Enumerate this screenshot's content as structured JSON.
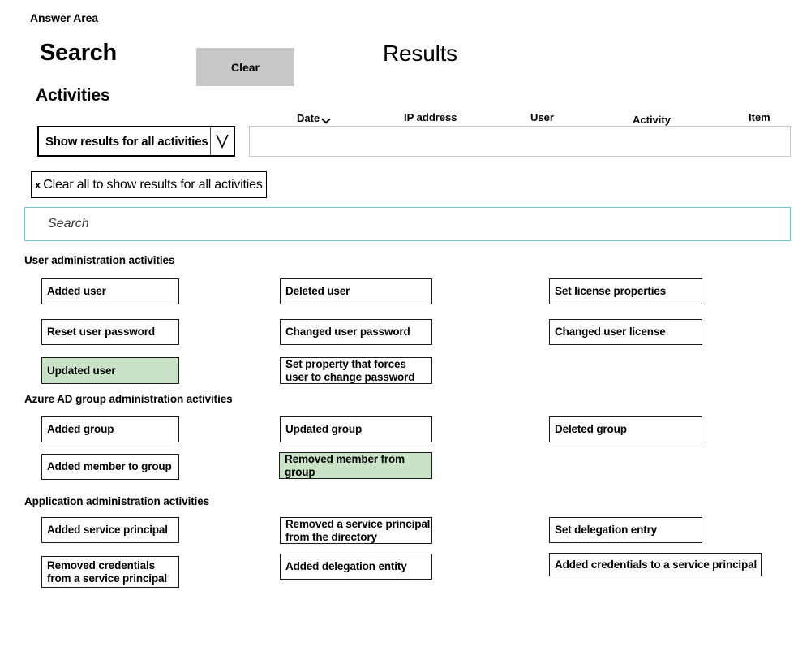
{
  "answer_area_label": "Answer Area",
  "search_panel": {
    "heading": "Search",
    "clear_button_label": "Clear",
    "activities_heading": "Activities",
    "dropdown_value": "Show results for all activities",
    "dropdown_icon": "chevron-down-icon",
    "clear_all_chip": {
      "remove_icon": "x",
      "label": "Clear all to show results for all activities"
    },
    "search_placeholder": "Search",
    "search_value": ""
  },
  "results_panel": {
    "heading": "Results",
    "columns": [
      {
        "label": "Date",
        "sort_icon": "chevron-down-icon"
      },
      {
        "label": "IP address",
        "sort_icon": ""
      },
      {
        "label": "User",
        "sort_icon": ""
      },
      {
        "label": "Activity",
        "sort_icon": ""
      },
      {
        "label": "Item",
        "sort_icon": ""
      }
    ],
    "rows": []
  },
  "colors": {
    "selected_highlight": "#c8e3c8",
    "clear_button_gray": "#c8c8c8",
    "search_border_teal": "#7cc0cc",
    "box_border": "#1a1a1a"
  },
  "sections": [
    {
      "heading": "User administration activities",
      "options": [
        {
          "label": "Added user",
          "selected": false
        },
        {
          "label": "Deleted user",
          "selected": false
        },
        {
          "label": "Set license properties",
          "selected": false
        },
        {
          "label": "Reset user password",
          "selected": false
        },
        {
          "label": "Changed user password",
          "selected": false
        },
        {
          "label": "Changed user license",
          "selected": false
        },
        {
          "label": "Updated user",
          "selected": true
        },
        {
          "label": "Set property that forces user to change password",
          "selected": false
        }
      ]
    },
    {
      "heading": "Azure AD group administration activities",
      "options": [
        {
          "label": "Added group",
          "selected": false
        },
        {
          "label": "Updated group",
          "selected": false
        },
        {
          "label": "Deleted group",
          "selected": false
        },
        {
          "label": "Added member to group",
          "selected": false
        },
        {
          "label": "Removed member from group",
          "selected": true
        }
      ]
    },
    {
      "heading": "Application administration activities",
      "options": [
        {
          "label": "Added service principal",
          "selected": false
        },
        {
          "label": "Removed a service principal from the directory",
          "selected": false
        },
        {
          "label": "Set delegation entry",
          "selected": false
        },
        {
          "label": "Removed credentials from a service principal",
          "selected": false
        },
        {
          "label": "Added delegation entity",
          "selected": false
        },
        {
          "label": "Added credentials to a service principal",
          "selected": false
        }
      ]
    }
  ]
}
